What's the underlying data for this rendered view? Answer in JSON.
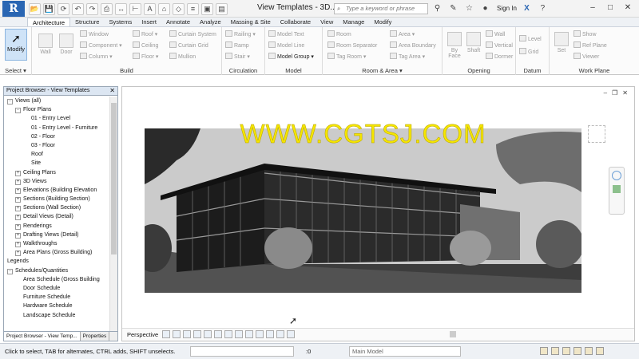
{
  "app": {
    "logo_letter": "R",
    "window_title": "View Templates - 3D...",
    "search_placeholder": "Type a keyword or phrase",
    "signin_label": "Sign In"
  },
  "qat": [
    "open-icon",
    "save-icon",
    "sync-icon",
    "undo-icon",
    "redo-icon",
    "print-icon",
    "measure-icon",
    "dimension-icon",
    "text-icon",
    "3d-view-icon",
    "section-icon",
    "thin-lines-icon",
    "close-hidden-icon",
    "switch-windows-icon"
  ],
  "ribbon_tabs": [
    "Architecture",
    "Structure",
    "Systems",
    "Insert",
    "Annotate",
    "Analyze",
    "Massing & Site",
    "Collaborate",
    "View",
    "Manage",
    "Modify"
  ],
  "ribbon_tabs_active": "Architecture",
  "ribbon": {
    "modify_label": "Modify",
    "select_label": "Select",
    "panels": {
      "build": "Build",
      "circulation": "Circulation",
      "model": "Model",
      "room_area": "Room & Area",
      "opening": "Opening",
      "datum": "Datum",
      "work_plane": "Work Plane"
    },
    "build_items": {
      "wall": "Wall",
      "door": "Door",
      "window": "Window",
      "component": "Component",
      "column": "Column",
      "roof": "Roof",
      "ceiling": "Ceiling",
      "floor": "Floor",
      "curtain_system": "Curtain System",
      "curtain_grid": "Curtain Grid",
      "mullion": "Mullion"
    },
    "circulation_items": {
      "railing": "Railing",
      "ramp": "Ramp",
      "stair": "Stair"
    },
    "model_items": {
      "model_text": "Model Text",
      "model_line": "Model Line",
      "model_group": "Model Group"
    },
    "room_items": {
      "room": "Room",
      "room_separator": "Room Separator",
      "tag_room": "Tag Room",
      "area": "Area",
      "area_boundary": "Area Boundary",
      "tag_area": "Tag Area"
    },
    "opening_items": {
      "by_face": "By Face",
      "shaft": "Shaft",
      "wall": "Wall",
      "vertical": "Vertical",
      "dormer": "Dormer"
    },
    "datum_items": {
      "level": "Level",
      "grid": "Grid"
    },
    "work_plane_items": {
      "set": "Set",
      "show": "Show",
      "ref_plane": "Ref Plane",
      "viewer": "Viewer"
    }
  },
  "project_browser": {
    "title": "Project Browser - View Templates",
    "tree": [
      {
        "label": "Views (all)",
        "level": 0,
        "exp": "-"
      },
      {
        "label": "Floor Plans",
        "level": 1,
        "exp": "-"
      },
      {
        "label": "01 - Entry Level",
        "level": 3,
        "exp": ""
      },
      {
        "label": "01 - Entry Level - Furniture",
        "level": 3,
        "exp": ""
      },
      {
        "label": "02 - Floor",
        "level": 3,
        "exp": ""
      },
      {
        "label": "03 - Floor",
        "level": 3,
        "exp": ""
      },
      {
        "label": "Roof",
        "level": 3,
        "exp": ""
      },
      {
        "label": "Site",
        "level": 3,
        "exp": ""
      },
      {
        "label": "Ceiling Plans",
        "level": 1,
        "exp": "+"
      },
      {
        "label": "3D Views",
        "level": 1,
        "exp": "+"
      },
      {
        "label": "Elevations (Building Elevation",
        "level": 1,
        "exp": "+"
      },
      {
        "label": "Sections (Building Section)",
        "level": 1,
        "exp": "+"
      },
      {
        "label": "Sections (Wall Section)",
        "level": 1,
        "exp": "+"
      },
      {
        "label": "Detail Views (Detail)",
        "level": 1,
        "exp": "+"
      },
      {
        "label": "Renderings",
        "level": 1,
        "exp": "+"
      },
      {
        "label": "Drafting Views (Detail)",
        "level": 1,
        "exp": "+"
      },
      {
        "label": "Walkthroughs",
        "level": 1,
        "exp": "+"
      },
      {
        "label": "Area Plans (Gross Building)",
        "level": 1,
        "exp": "+"
      },
      {
        "label": "Legends",
        "level": 0,
        "exp": ""
      },
      {
        "label": "Schedules/Quantities",
        "level": 0,
        "exp": "-"
      },
      {
        "label": "Area Schedule (Gross Building",
        "level": 2,
        "exp": ""
      },
      {
        "label": "Door Schedule",
        "level": 2,
        "exp": ""
      },
      {
        "label": "Furniture Schedule",
        "level": 2,
        "exp": ""
      },
      {
        "label": "Hardware Schedule",
        "level": 2,
        "exp": ""
      },
      {
        "label": "Landscape Schedule",
        "level": 2,
        "exp": ""
      }
    ],
    "tab_browser": "Project Browser - View Temp...",
    "tab_properties": "Properties"
  },
  "view": {
    "name": "Perspective",
    "watermark": "WWW.CGTSJ.COM"
  },
  "status": {
    "text": "Click to select, TAB for alternates, CTRL adds, SHIFT unselects.",
    "value": ":0",
    "model_combo": "Main Model"
  },
  "colors": {
    "accent": "#2a66b3",
    "watermark": "#f5e600",
    "sky": "#c9c9c9",
    "building_dark": "#1a1a1a"
  }
}
